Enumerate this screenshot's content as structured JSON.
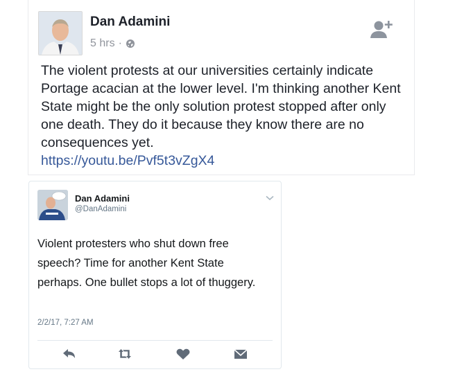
{
  "facebook_post": {
    "author_name": "Dan Adamini",
    "timestamp": "5 hrs",
    "separator": "·",
    "privacy_icon": "globe-icon",
    "action_icon": "add-friend-icon",
    "body_text": "The violent protests at our universities certainly indicate Portage acacian at the lower level. I'm thinking another Kent State might be the only solution protest stopped after only one death. They do it because they know there are no consequences yet.",
    "link_text": "https://youtu.be/Pvf5t3vZgX4"
  },
  "embedded_tweet": {
    "display_name": "Dan Adamini",
    "handle": "@DanAdamini",
    "menu_icon": "chevron-down-icon",
    "text": "Violent protesters who shut down free speech? Time for another Kent State perhaps. One bullet stops a lot of thuggery.",
    "timestamp": "2/2/17, 7:27 AM",
    "actions": [
      "reply-icon",
      "retweet-icon",
      "like-icon",
      "message-icon"
    ]
  },
  "colors": {
    "link": "#365899",
    "meta_gray": "#90949c",
    "twitter_gray": "#657786",
    "twitter_border": "#e1e8ed"
  }
}
